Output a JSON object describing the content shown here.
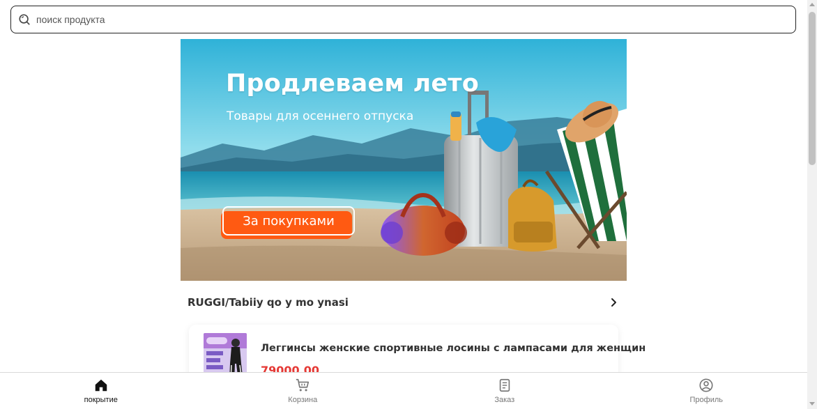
{
  "search": {
    "placeholder": "поиск продукта"
  },
  "banner": {
    "title": "Продлеваем лето",
    "subtitle": "Товары для осеннего отпуска",
    "cta_label": "За покупками"
  },
  "section": {
    "title": "RUGGI/Tabiiy qo y mo ynasi"
  },
  "product": {
    "name": "Леггинсы женские спортивные лосины с лампасами для женщин",
    "price": "79000.00"
  },
  "nav": {
    "items": [
      {
        "label": "покрытие",
        "icon": "home-icon",
        "active": true
      },
      {
        "label": "Корзина",
        "icon": "cart-icon",
        "active": false
      },
      {
        "label": "Заказ",
        "icon": "order-icon",
        "active": false
      },
      {
        "label": "Профиль",
        "icon": "profile-icon",
        "active": false
      }
    ]
  },
  "colors": {
    "accent": "#ff5a12",
    "price": "#e53935",
    "nav_active": "#111111",
    "nav_inactive": "#777777"
  }
}
